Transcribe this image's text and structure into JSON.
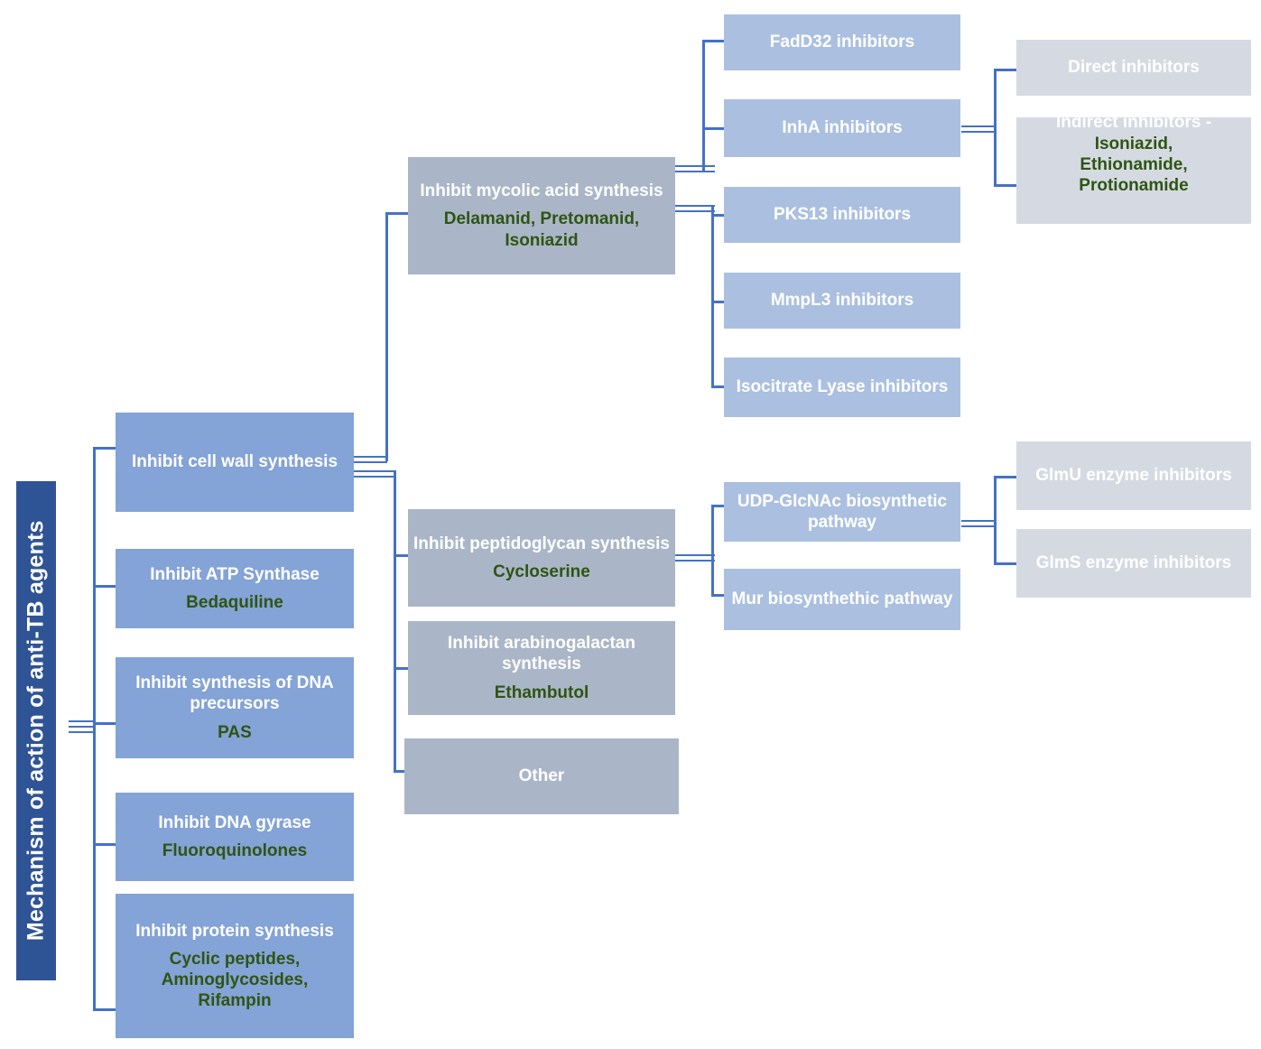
{
  "diagram": {
    "title": "Mechanism of action of anti-TB agents",
    "colors": {
      "root": "#2f5496",
      "level1": "#84a3d6",
      "level2": "#aab6c8",
      "level3": "#abc0e0",
      "level4": "#d5dae2",
      "connector": "#4472c4",
      "drug_text": "#2f5512",
      "node_text": "#ffffff"
    }
  },
  "root": {
    "label": "Mechanism of action of anti-TB agents"
  },
  "level1": [
    {
      "title": "Inhibit cell wall synthesis",
      "drugs": ""
    },
    {
      "title": "Inhibit ATP Synthase",
      "drugs": "Bedaquiline"
    },
    {
      "title": "Inhibit synthesis of DNA precursors",
      "drugs": "PAS"
    },
    {
      "title": "Inhibit DNA gyrase",
      "drugs": "Fluoroquinolones"
    },
    {
      "title": "Inhibit protein synthesis",
      "drugs": "Cyclic peptides, Aminoglycosides, Rifampin"
    }
  ],
  "level2": [
    {
      "title": "Inhibit mycolic acid synthesis",
      "drugs": "Delamanid, Pretomanid, Isoniazid"
    },
    {
      "title": "Inhibit peptidoglycan synthesis",
      "drugs": "Cycloserine"
    },
    {
      "title": "Inhibit arabinogalactan synthesis",
      "drugs": "Ethambutol"
    },
    {
      "title": "Other",
      "drugs": ""
    }
  ],
  "level3": [
    {
      "title": "FadD32 inhibitors"
    },
    {
      "title": "InhA inhibitors"
    },
    {
      "title": "PKS13 inhibitors"
    },
    {
      "title": "MmpL3 inhibitors"
    },
    {
      "title": "Isocitrate Lyase inhibitors"
    },
    {
      "title": "UDP-GlcNAc biosynthetic pathway"
    },
    {
      "title": "Mur biosynthethic pathway"
    }
  ],
  "level4": [
    {
      "title": "Direct inhibitors",
      "drugs": ""
    },
    {
      "title": "Indirect inhibitors -",
      "drugs": "Isoniazid, Ethionamide, Protionamide"
    },
    {
      "title": "GlmU enzyme inhibitors",
      "drugs": ""
    },
    {
      "title": "GlmS enzyme inhibitors",
      "drugs": ""
    }
  ]
}
